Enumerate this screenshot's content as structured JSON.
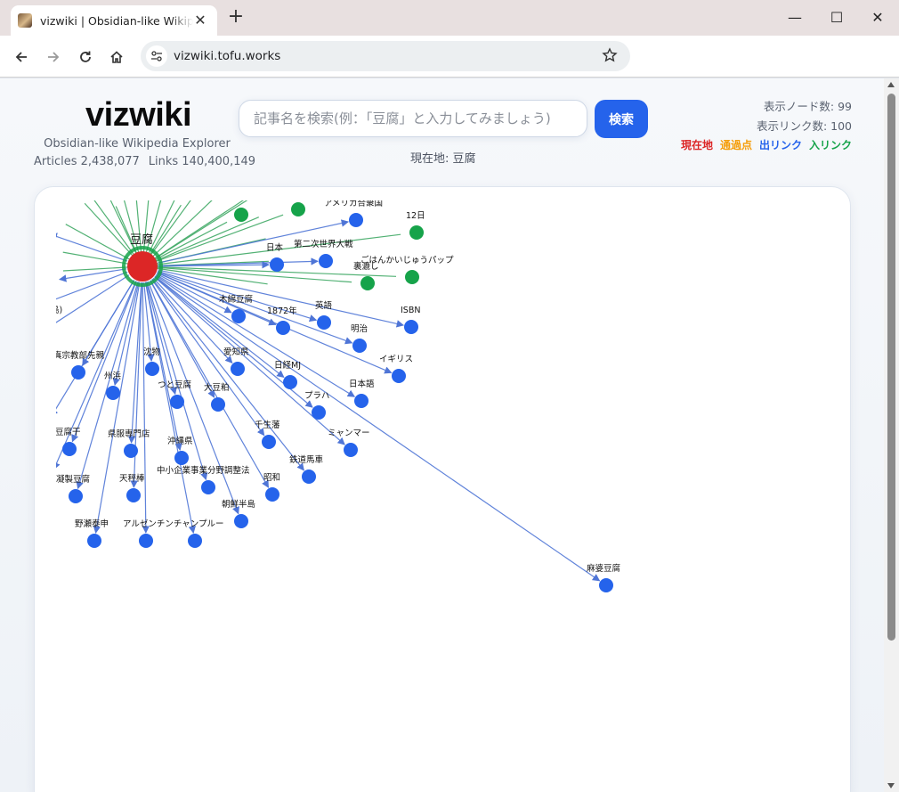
{
  "browser": {
    "tab_title": "vizwiki | Obsidian-like Wikipedia Explorer",
    "url": "vizwiki.tofu.works"
  },
  "header": {
    "logo": "vizwiki",
    "tagline": "Obsidian-like Wikipedia Explorer",
    "articles": "Articles 2,438,077",
    "links": "Links 140,400,149"
  },
  "search": {
    "placeholder": "記事名を検索(例：「豆腐」と入力してみましょう)",
    "button": "検索",
    "current_location": "現在地: 豆腐"
  },
  "stats": {
    "nodes": "表示ノード数: 99",
    "links": "表示リンク数: 100"
  },
  "legend": [
    {
      "label": "現在地",
      "color": "#dc2626"
    },
    {
      "label": "通過点",
      "color": "#f59e0b"
    },
    {
      "label": "出リンク",
      "color": "#2563eb"
    },
    {
      "label": "入リンク",
      "color": "#16a34a"
    }
  ],
  "graph": {
    "center": {
      "label": "豆腐",
      "color": "#dc2626"
    },
    "outgoing_nodes": [
      "アメリカ合衆国",
      "日本",
      "第二次世界大戦",
      "木綿豆腐",
      "1872年",
      "英語",
      "ISBN",
      "明治",
      "イギリス",
      "日経MJ",
      "日本語",
      "愛知県",
      "沈物",
      "州浜",
      "つと豆腐",
      "大豆粕",
      "プラハ",
      "千生藩",
      "ミャンマー",
      "沖縄県",
      "県服専門店",
      "豆腐干",
      "鉄道馬車",
      "中小企業事業分野調整法",
      "昭和",
      "凝製豆腐",
      "天秤棒",
      "朝鮮半島",
      "野瀬泰申",
      "アルゼンチンチャンプルー",
      "麻婆豆腐",
      "真宗教部先親",
      "鳥)"
    ],
    "incoming_nodes": [
      "12日",
      "裏漉し",
      "ごはんかいじゅうパップ"
    ],
    "colors": {
      "outgoing": "#2563eb",
      "incoming": "#16a34a",
      "edge_out": "#4f75d6",
      "edge_in": "#3fa965"
    }
  }
}
